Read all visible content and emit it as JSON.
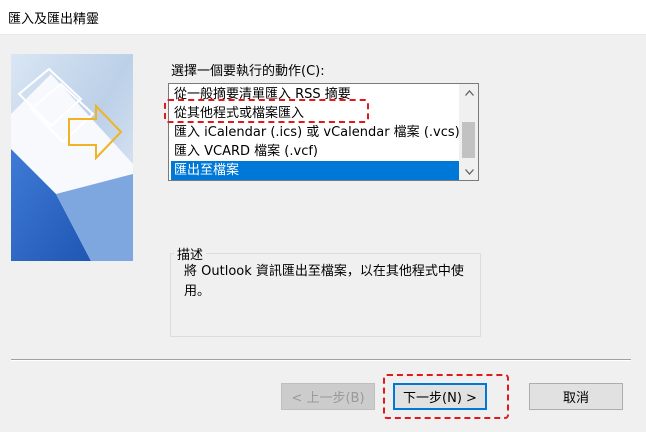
{
  "window": {
    "title": "匯入及匯出精靈"
  },
  "prompt": "選擇一個要執行的動作(C):",
  "actions": [
    {
      "label": "從一般摘要清單匯入 RSS 摘要",
      "selected": false
    },
    {
      "label": "從其他程式或檔案匯入",
      "selected": false
    },
    {
      "label": "匯入 iCalendar (.ics) 或 vCalendar 檔案 (.vcs)",
      "selected": false
    },
    {
      "label": "匯入 VCARD 檔案 (.vcf)",
      "selected": false
    },
    {
      "label": "匯出至檔案",
      "selected": true
    }
  ],
  "description": {
    "legend": "描述",
    "text": "將 Outlook 資訊匯出至檔案，以在其他程式中使用。"
  },
  "buttons": {
    "back": "< 上一步(B)",
    "next": "下一步(N) >",
    "cancel": "取消"
  },
  "colors": {
    "selection": "#0078d7",
    "annotation": "#e0191b"
  }
}
